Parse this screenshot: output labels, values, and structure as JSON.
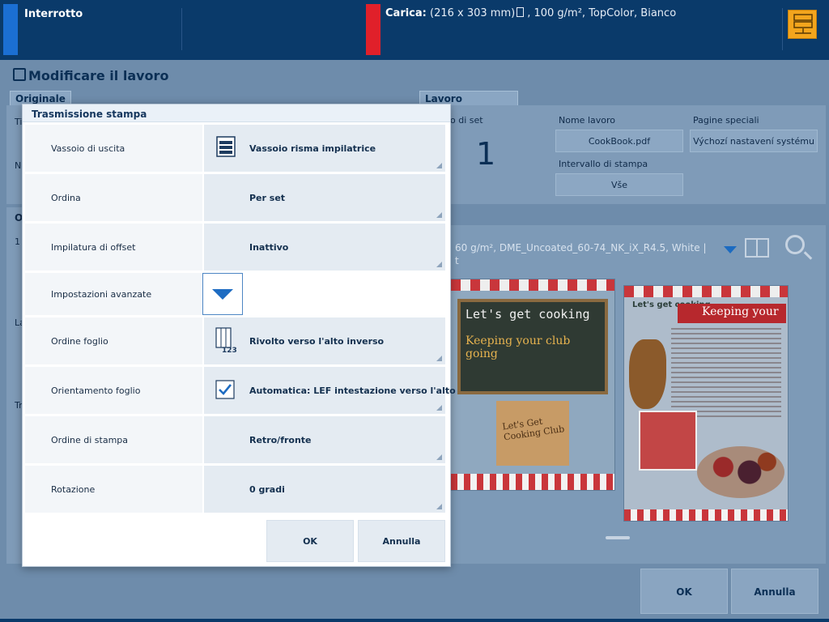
{
  "topbar": {
    "status": "Interrotto",
    "load_label": "Carica:",
    "load_size": "(216 x 303 mm)",
    "load_details": ", 100 g/m², TopColor, Bianco"
  },
  "window": {
    "title": "Modificare il lavoro",
    "tab_original": "Originale",
    "tab_job": "Lavoro",
    "labels": {
      "sets": "o di set",
      "job_name": "Nome lavoro",
      "special_pages": "Pagine speciali",
      "print_range": "Intervallo di stampa",
      "left1": "Ti",
      "left2": "N",
      "left3": "O",
      "left4": "1",
      "left5": "La",
      "left6": "Tr"
    },
    "sets_value": "1",
    "job_name_value": "CookBook.pdf",
    "special_pages_value": "Výchozí nastavení systému",
    "print_range_value": "Vše",
    "preview_info_line1": "60 g/m², DME_Uncoated_60-74_NK_iX_R4.5, White |",
    "preview_info_line2": "t",
    "ok": "OK",
    "cancel": "Annulla",
    "preview": {
      "chalk_title": "Let's get cooking",
      "chalk_sub": "Keeping your club going",
      "box_text": "Let's Get Cooking Club",
      "right_logo": "Let's get cooking",
      "right_header": "Keeping your"
    }
  },
  "dialog": {
    "title": "Trasmissione stampa",
    "rows": [
      {
        "label": "Vassoio di uscita",
        "value": "Vassoio risma impilatrice"
      },
      {
        "label": "Ordina",
        "value": "Per set"
      },
      {
        "label": "Impilatura di offset",
        "value": "Inattivo"
      },
      {
        "label": "Ordine foglio",
        "value": "Rivolto verso l'alto inverso"
      },
      {
        "label": "Orientamento foglio",
        "value": "Automatica: LEF intestazione verso l'alto"
      },
      {
        "label": "Ordine di stampa",
        "value": "Retro/fronte"
      },
      {
        "label": "Rotazione",
        "value": "0 gradi"
      }
    ],
    "advanced_label": "Impostazioni avanzate",
    "sheet_order_icon_text": "123",
    "ok": "OK",
    "cancel": "Annulla"
  },
  "colors": {
    "accent_blue": "#1b6fd3",
    "alert_red": "#e0202a",
    "queue_orange": "#f3a51d"
  }
}
